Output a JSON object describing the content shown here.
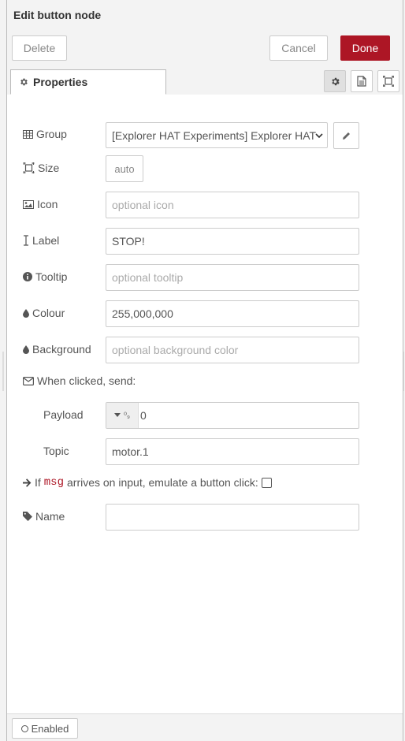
{
  "header": {
    "title": "Edit button node"
  },
  "toolbar": {
    "delete_label": "Delete",
    "cancel_label": "Cancel",
    "done_label": "Done"
  },
  "tabs": {
    "properties_label": "Properties",
    "icons": [
      "gear-icon",
      "description-icon",
      "appearance-icon"
    ],
    "active_index": 0
  },
  "form": {
    "group": {
      "label": "Group",
      "value": "[Explorer HAT Experiments] Explorer HAT"
    },
    "size": {
      "label": "Size",
      "value": "auto"
    },
    "icon": {
      "label": "Icon",
      "placeholder": "optional icon"
    },
    "label": {
      "label": "Label",
      "value": "STOP!"
    },
    "tooltip": {
      "label": "Tooltip",
      "placeholder": "optional tooltip"
    },
    "colour": {
      "label": "Colour",
      "value": "255,000,000"
    },
    "background": {
      "label": "Background",
      "placeholder": "optional background color"
    },
    "when_clicked": "When clicked, send:",
    "payload": {
      "label": "Payload",
      "type_glyph": "⁰₉",
      "value": "0"
    },
    "topic": {
      "label": "Topic",
      "value": "motor.1"
    },
    "emulate": {
      "prefix": "If",
      "code": "msg",
      "suffix": "arrives on input, emulate a button click:",
      "checked": false
    },
    "name": {
      "label": "Name",
      "value": ""
    }
  },
  "footer": {
    "enabled_label": "Enabled"
  },
  "colors": {
    "accent": "#ad1625",
    "border": "#cccccc",
    "background": "#f3f3f3"
  }
}
